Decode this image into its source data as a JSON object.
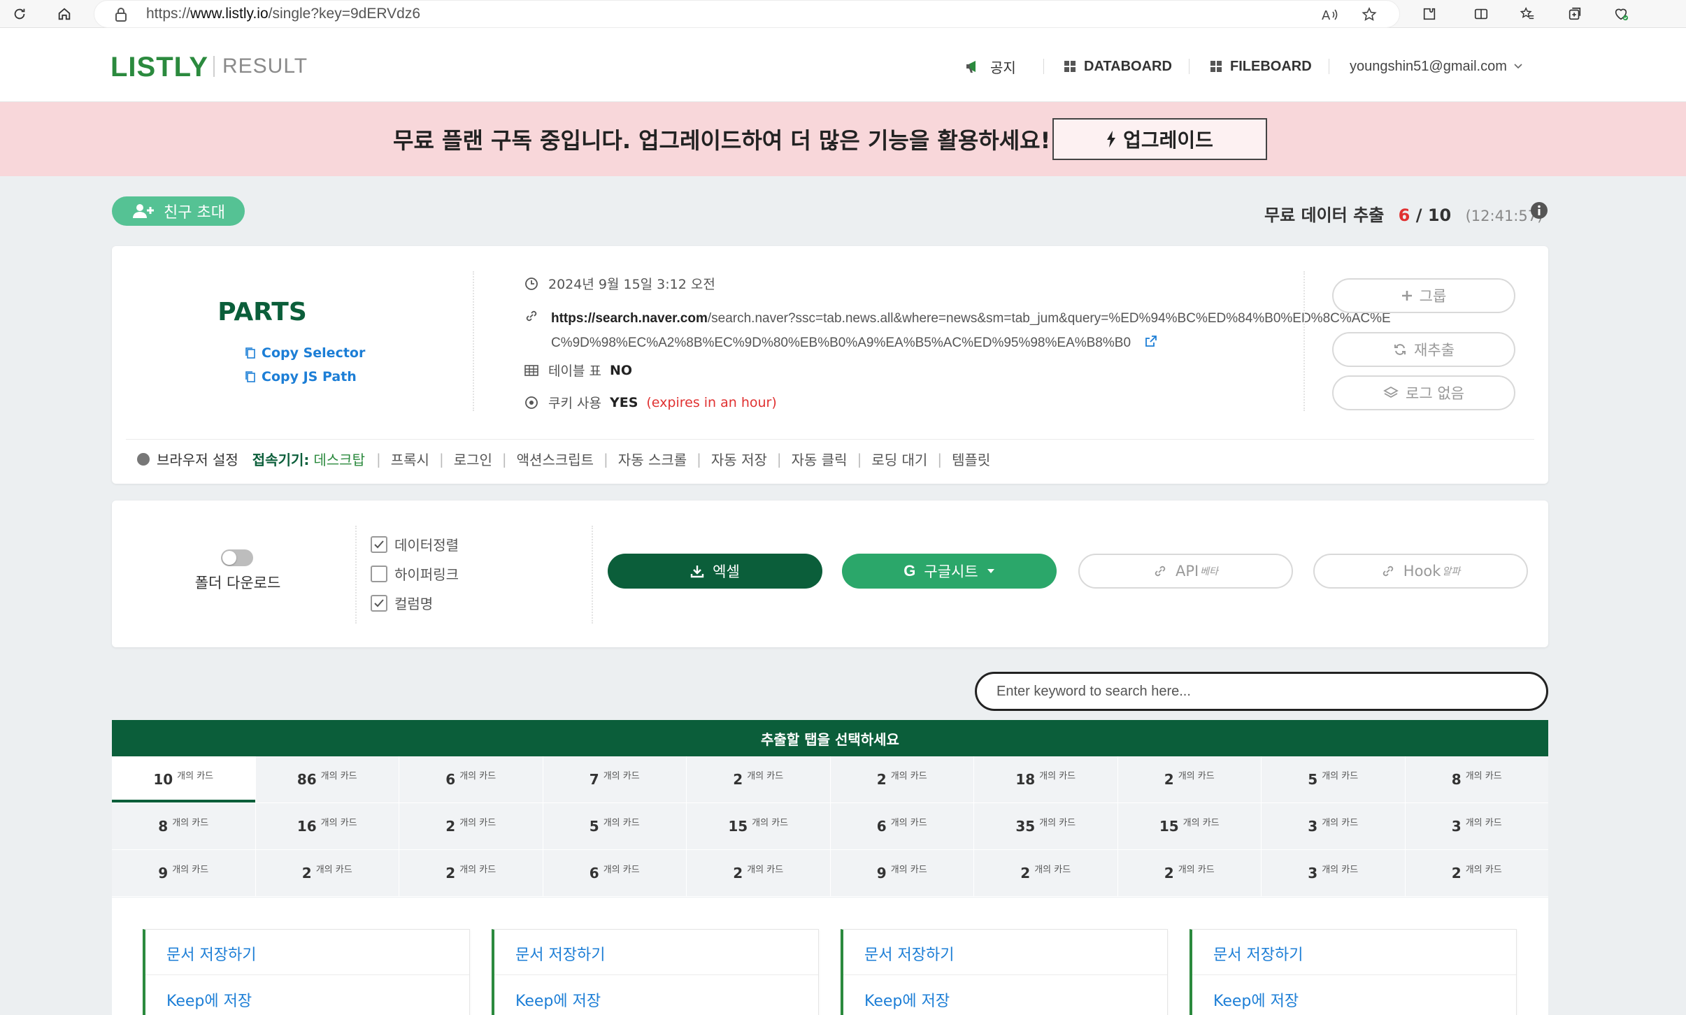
{
  "browser": {
    "url_prefix": "https://",
    "url_domain": "www.listly.io",
    "url_path": "/single?key=9dERVdz6",
    "icons": [
      "refresh-icon",
      "home-icon",
      "lock-icon",
      "read-aloud-icon",
      "favorite-star-icon",
      "extensions-icon",
      "split-screen-icon",
      "favorites-icon",
      "collections-icon",
      "browser-essentials-icon"
    ]
  },
  "header": {
    "logo": "LISTLY",
    "result_label": "RESULT",
    "nav": {
      "notice": "공지",
      "databoard": "DATABOARD",
      "fileboard": "FILEBOARD",
      "account": "youngshin51@gmail.com"
    }
  },
  "banner": {
    "text": "무료 플랜 구독 중입니다. 업그레이드하여 더 많은 기능을 활용하세요!",
    "upgrade_label": "업그레이드"
  },
  "invite": {
    "label": "친구 초대"
  },
  "quota": {
    "label": "무료 데이터 추출",
    "used": "6",
    "slash": "/",
    "total": "10",
    "time": "(12:41:57)"
  },
  "summary": {
    "title": "PARTS",
    "copy_selector": "Copy Selector",
    "copy_js_path": "Copy JS Path",
    "datetime": "2024년 9월 15일 3:12 오전",
    "url_bold": "https://search.naver.com",
    "url_rest": "/search.naver?ssc=tab.news.all&where=news&sm=tab_jum&query=%ED%94%BC%ED%84%B0%ED%8C%AC%EC%9D%98%EC%A2%8B%EC%9D%80%EB%B0%A9%EA%B5%AC%ED%95%98%EA%B8%B0",
    "table_label": "테이블 표",
    "table_value": "NO",
    "cookie_label": "쿠키 사용",
    "cookie_value": "YES",
    "cookie_note": "(expires in an hour)",
    "buttons": {
      "group": "그룹",
      "reextract": "재추출",
      "no_log": "로그 없음"
    },
    "browser_settings": {
      "label": "브라우저 설정",
      "device_label": "접속기기:",
      "device_value": "데스크탑",
      "options": [
        "프록시",
        "로그인",
        "액션스크립트",
        "자동 스크롤",
        "자동 저장",
        "자동 클릭",
        "로딩 대기",
        "템플릿"
      ]
    }
  },
  "download": {
    "folder_download": "폴더 다운로드",
    "options": [
      {
        "label": "데이터정렬",
        "checked": true
      },
      {
        "label": "하이퍼링크",
        "checked": false
      },
      {
        "label": "컬럼명",
        "checked": true
      }
    ],
    "excel": "엑셀",
    "gsheet": "구글시트",
    "api": "API",
    "api_badge": "베타",
    "hook": "Hook",
    "hook_badge": "알파"
  },
  "search": {
    "placeholder": "Enter keyword to search here..."
  },
  "tabs": {
    "header": "추출할 탭을 선택하세요",
    "unit": "개의 카드",
    "rows": [
      [
        "10",
        "86",
        "6",
        "7",
        "2",
        "2",
        "18",
        "2",
        "5",
        "8"
      ],
      [
        "8",
        "16",
        "2",
        "5",
        "15",
        "6",
        "35",
        "15",
        "3",
        "3"
      ],
      [
        "9",
        "2",
        "2",
        "6",
        "2",
        "9",
        "2",
        "2",
        "3",
        "2"
      ]
    ]
  },
  "results": [
    {
      "save_doc": "문서 저장하기",
      "keep": "Keep에 저장"
    },
    {
      "save_doc": "문서 저장하기",
      "keep": "Keep에 저장"
    },
    {
      "save_doc": "문서 저장하기",
      "keep": "Keep에 저장"
    },
    {
      "save_doc": "문서 저장하기",
      "keep": "Keep에 저장"
    }
  ]
}
